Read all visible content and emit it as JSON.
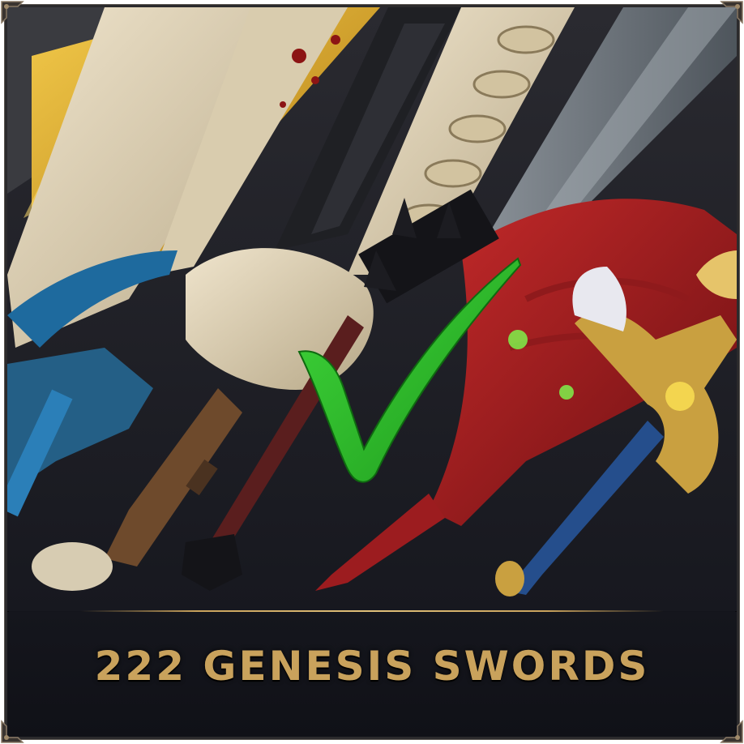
{
  "banner": {
    "title": "222 GENESIS SWORDS"
  },
  "colors": {
    "accent_gold": "#c9a25c",
    "checkmark_green": "#2fc12a",
    "background": "#14151b"
  },
  "icons": {
    "overlay": "checkmark-icon",
    "frame_corner": "ornate-corner-icon"
  }
}
